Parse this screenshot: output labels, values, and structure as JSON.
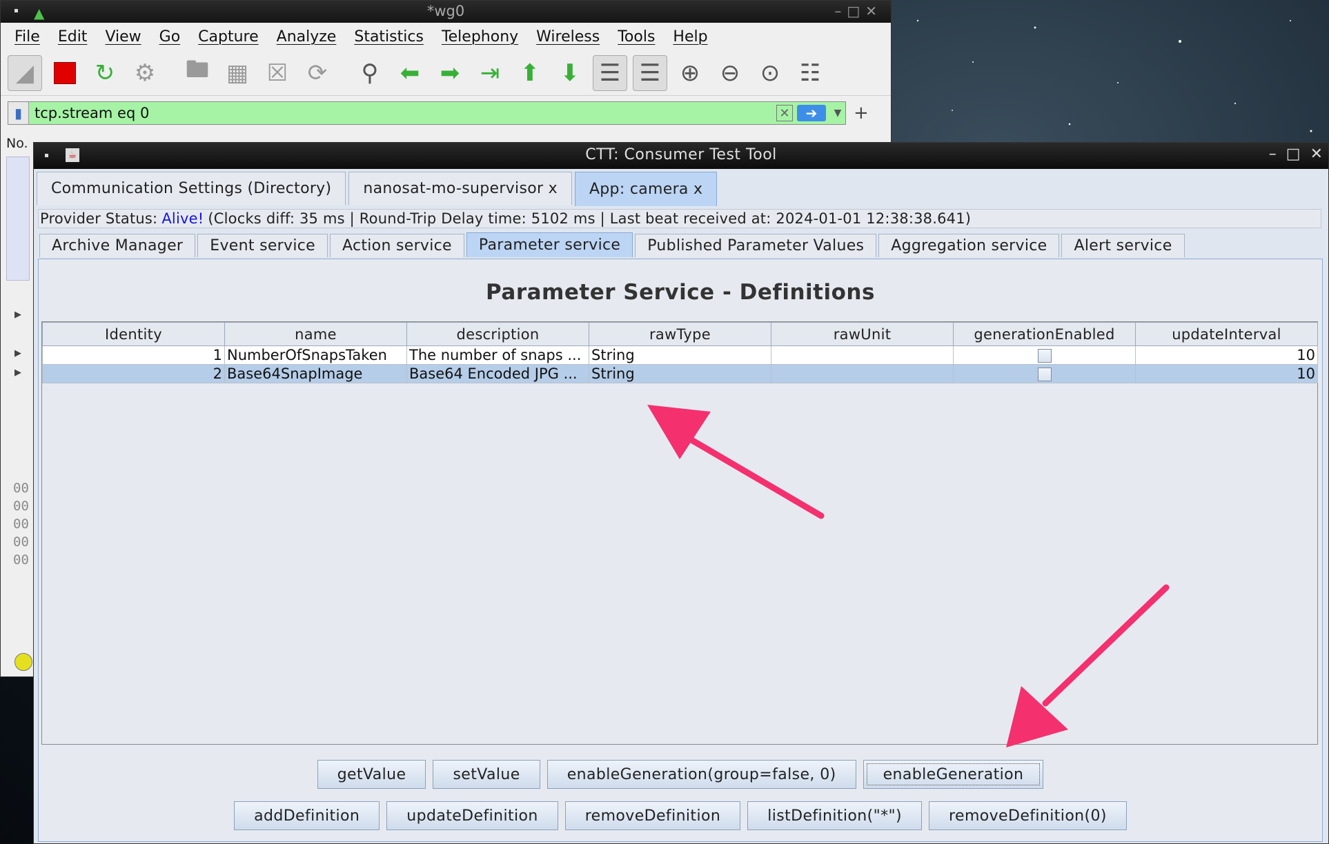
{
  "wireshark": {
    "title": "*wg0",
    "menu": [
      "File",
      "Edit",
      "View",
      "Go",
      "Capture",
      "Analyze",
      "Statistics",
      "Telephony",
      "Wireless",
      "Tools",
      "Help"
    ],
    "filter_value": "tcp.stream eq 0",
    "column_no": "No.",
    "hex_rows": [
      "00",
      "00",
      "00",
      "00",
      "00"
    ]
  },
  "ctt": {
    "title": "CTT: Consumer Test Tool",
    "top_tabs": [
      {
        "label": "Communication Settings (Directory)",
        "active": false
      },
      {
        "label": "nanosat-mo-supervisor x",
        "active": false
      },
      {
        "label": "App: camera x",
        "active": true
      }
    ],
    "status": {
      "prefix": "Provider Status:",
      "alive": "Alive!",
      "details": "(Clocks diff: 35 ms | Round-Trip Delay time: 5102 ms | Last beat received at: 2024-01-01 12:38:38.641)"
    },
    "service_tabs": [
      {
        "label": "Archive Manager",
        "active": false
      },
      {
        "label": "Event service",
        "active": false
      },
      {
        "label": "Action service",
        "active": false
      },
      {
        "label": "Parameter service",
        "active": true
      },
      {
        "label": "Published Parameter Values",
        "active": false
      },
      {
        "label": "Aggregation service",
        "active": false
      },
      {
        "label": "Alert service",
        "active": false
      }
    ],
    "panel_title": "Parameter Service - Definitions",
    "table": {
      "columns": [
        "Identity",
        "name",
        "description",
        "rawType",
        "rawUnit",
        "generationEnabled",
        "updateInterval"
      ],
      "rows": [
        {
          "identity": "1",
          "name": "NumberOfSnapsTaken",
          "description": "The number of snaps ...",
          "rawType": "String",
          "rawUnit": "",
          "generationEnabled": false,
          "updateInterval": "10",
          "selected": false
        },
        {
          "identity": "2",
          "name": "Base64SnapImage",
          "description": "Base64 Encoded JPG ...",
          "rawType": "String",
          "rawUnit": "",
          "generationEnabled": false,
          "updateInterval": "10",
          "selected": true
        }
      ]
    },
    "buttons_row1": [
      "getValue",
      "setValue",
      "enableGeneration(group=false, 0)",
      "enableGeneration"
    ],
    "buttons_row2": [
      "addDefinition",
      "updateDefinition",
      "removeDefinition",
      "listDefinition(\"*\")",
      "removeDefinition(0)"
    ]
  },
  "colors": {
    "annotation_arrow": "#f4306e",
    "filter_bg": "#a6f3a6",
    "selected_row": "#b5cde8",
    "active_tab": "#bcd5f4",
    "alive_text": "#1414e6"
  }
}
